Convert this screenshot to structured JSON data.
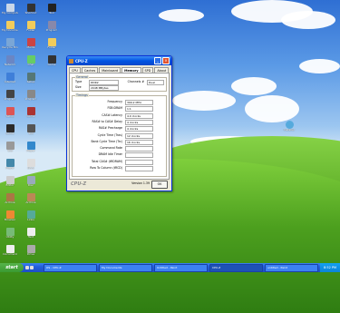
{
  "desktop": {
    "icons_col1": [
      {
        "label": "My Computer",
        "icon": "computer-icon",
        "color": "#c9d6e8"
      },
      {
        "label": "My Documents",
        "icon": "folder-icon",
        "color": "#f2cc5c"
      },
      {
        "label": "Recycle Bin",
        "icon": "recycle-bin-icon",
        "color": "#7aa6d6"
      },
      {
        "label": "Network",
        "icon": "network-icon",
        "color": "#6a86c4"
      },
      {
        "label": "Internet",
        "icon": "ie-icon",
        "color": "#3f7fd9"
      },
      {
        "label": "Program",
        "icon": "app-icon",
        "color": "#444"
      },
      {
        "label": "Setup",
        "icon": "app-icon",
        "color": "#d55"
      },
      {
        "label": "Game",
        "icon": "game-icon",
        "color": "#2b2b2b"
      },
      {
        "label": "Tool",
        "icon": "app-icon",
        "color": "#999"
      },
      {
        "label": "Player",
        "icon": "media-icon",
        "color": "#48a"
      },
      {
        "label": "Editor",
        "icon": "app-icon",
        "color": "#ccc"
      },
      {
        "label": "Archive",
        "icon": "zip-icon",
        "color": "#a74"
      },
      {
        "label": "Browser",
        "icon": "app-icon",
        "color": "#e83"
      },
      {
        "label": "Utility",
        "icon": "app-icon",
        "color": "#7b7"
      },
      {
        "label": "Document",
        "icon": "file-icon",
        "color": "#eee"
      }
    ],
    "icons_col2": [
      {
        "label": "Shortcut",
        "icon": "app-icon",
        "color": "#333"
      },
      {
        "label": "Folder",
        "icon": "folder-icon",
        "color": "#f2cc5c"
      },
      {
        "label": "Media",
        "icon": "media-icon",
        "color": "#c44"
      },
      {
        "label": "Chat",
        "icon": "chat-icon",
        "color": "#6c6"
      },
      {
        "label": "Setup",
        "icon": "app-icon",
        "color": "#577"
      },
      {
        "label": "Program",
        "icon": "app-icon",
        "color": "#888"
      },
      {
        "label": "Game",
        "icon": "game-icon",
        "color": "#a33"
      },
      {
        "label": "Tool",
        "icon": "app-icon",
        "color": "#555"
      },
      {
        "label": "Player",
        "icon": "media-icon",
        "color": "#38c"
      },
      {
        "label": "Docs",
        "icon": "file-icon",
        "color": "#ddd"
      },
      {
        "label": "Disc",
        "icon": "disc-icon",
        "color": "#9ab"
      },
      {
        "label": "Archive",
        "icon": "zip-icon",
        "color": "#b85"
      },
      {
        "label": "Links",
        "icon": "app-icon",
        "color": "#5a9"
      },
      {
        "label": "Text",
        "icon": "file-icon",
        "color": "#eee"
      },
      {
        "label": "Drive",
        "icon": "drive-icon",
        "color": "#aaa"
      }
    ],
    "icons_col3": [
      {
        "label": "Tool",
        "icon": "app-icon",
        "color": "#222"
      },
      {
        "label": "Program",
        "icon": "app-icon",
        "color": "#88a"
      },
      {
        "label": "Folder",
        "icon": "folder-icon",
        "color": "#f2cc5c"
      },
      {
        "label": "Game",
        "icon": "game-icon",
        "color": "#333"
      }
    ],
    "icon_right": {
      "label": "Installer",
      "icon": "disc-icon",
      "color": "#5ad"
    }
  },
  "window": {
    "title": "CPU-Z",
    "tabs": [
      "CPU",
      "Caches",
      "Mainboard",
      "Memory",
      "SPD",
      "About"
    ],
    "active_tab": "Memory",
    "general": {
      "label": "General",
      "rows": [
        {
          "label": "Type",
          "value": "DDR2",
          "label2": "Channels #",
          "value2": "Dual"
        },
        {
          "label": "Size",
          "value": "2048 MBytes",
          "label2": "",
          "value2": ""
        }
      ]
    },
    "timings": {
      "label": "Timings",
      "rows": [
        {
          "label": "Frequency",
          "value": "399.2 MHz"
        },
        {
          "label": "FSB:DRAM",
          "value": "1:1"
        },
        {
          "label": "CAS# Latency",
          "value": "4.0 clocks"
        },
        {
          "label": "RAS# to CAS# Delay",
          "value": "4 clocks"
        },
        {
          "label": "RAS# Precharge",
          "value": "4 clocks"
        },
        {
          "label": "Cycle Time (Tras)",
          "value": "12 clocks"
        },
        {
          "label": "Bank Cycle Time (Trc)",
          "value": "16 clocks"
        },
        {
          "label": "Command Rate",
          "value": ""
        },
        {
          "label": "DRAM Idle Timer",
          "value": ""
        },
        {
          "label": "Total CAS# (tRDRAM)",
          "value": ""
        },
        {
          "label": "Row To Column (tRCD)",
          "value": ""
        }
      ]
    },
    "footer": {
      "brand": "CPU-Z",
      "version": "Version 1.39",
      "ok": "OK"
    }
  },
  "taskbar": {
    "start": "start",
    "tasks": [
      "OS - CPU-Z",
      "My Documents",
      "Untitled - Paint",
      "CPU-Z",
      "untitled - Paint"
    ],
    "active_task": 3,
    "clock": "8:52 PM"
  }
}
